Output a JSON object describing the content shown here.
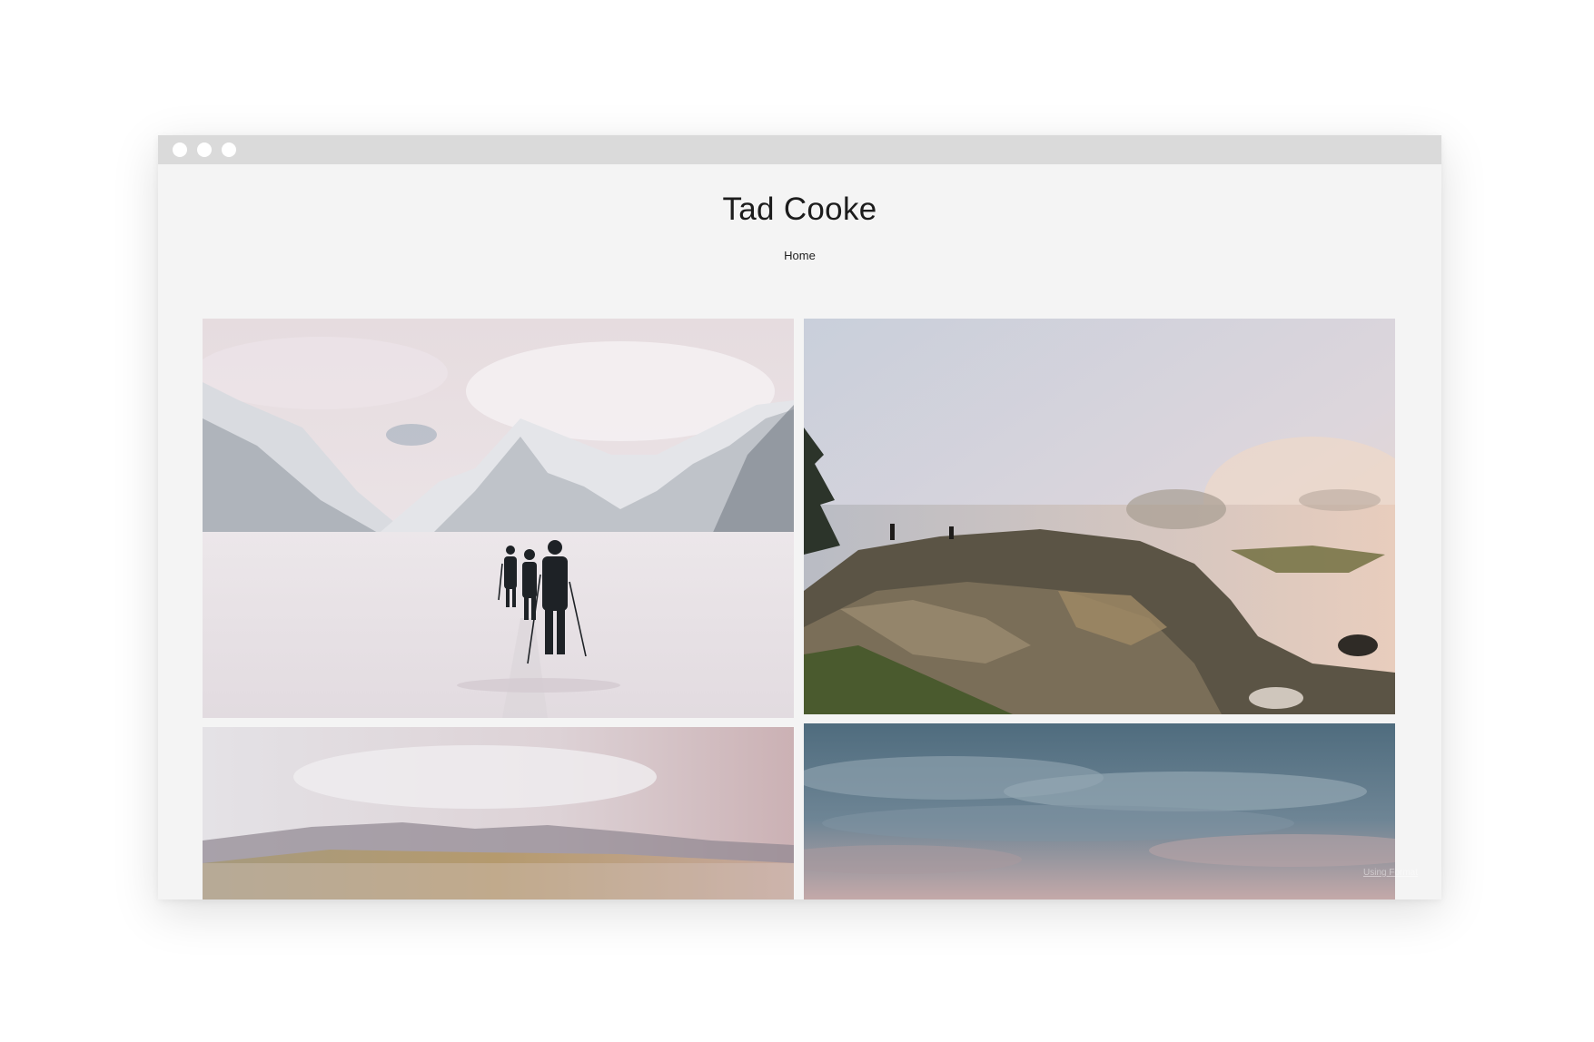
{
  "site": {
    "title": "Tad Cooke",
    "nav_home": "Home",
    "credit": "Using Format"
  },
  "photos": [
    {
      "name": "photo-snow-hikers",
      "subject": "skiers-on-glacier"
    },
    {
      "name": "photo-rocky-coast",
      "subject": "foggy-rocky-shoreline"
    },
    {
      "name": "photo-misty-hills",
      "subject": "misty-hills"
    },
    {
      "name": "photo-cloudy-sky",
      "subject": "cloudy-sky"
    }
  ],
  "colors": {
    "page_background": "#f4f4f4",
    "titlebar": "#dadada",
    "text": "#1c1c1c"
  }
}
